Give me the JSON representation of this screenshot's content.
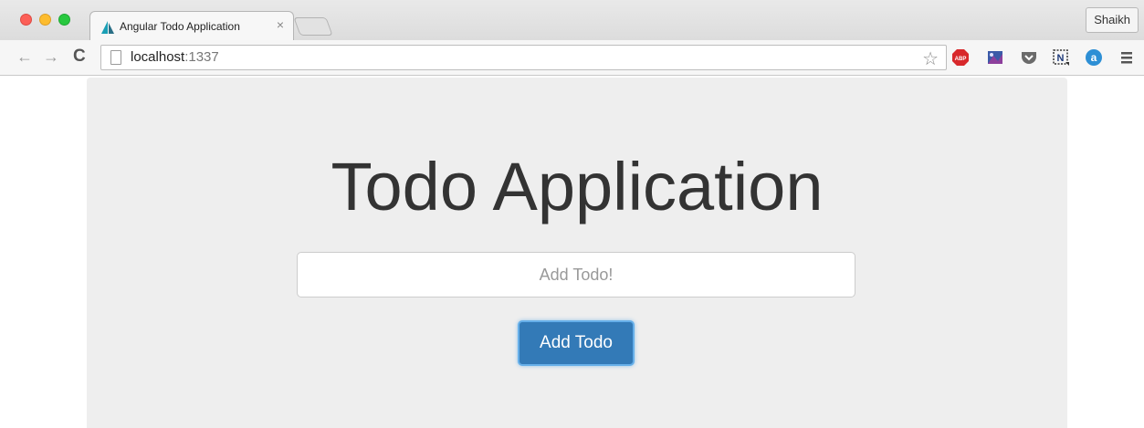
{
  "browser": {
    "tab": {
      "title": "Angular Todo Application",
      "close_glyph": "×"
    },
    "profile_name": "Shaikh",
    "toolbar": {
      "back_glyph": "←",
      "forward_glyph": "→",
      "reload_glyph": "C",
      "url_host": "localhost",
      "url_port": ":1337",
      "star_glyph": "☆",
      "menu_glyph": "≡"
    },
    "extensions": [
      "adblock-plus-icon",
      "image-extension-icon",
      "pocket-icon",
      "notion-clipper-icon",
      "at-sign-icon"
    ]
  },
  "page": {
    "title": "Todo Application",
    "input": {
      "placeholder": "Add Todo!",
      "value": ""
    },
    "add_button_label": "Add Todo"
  },
  "colors": {
    "primary_button": "#337ab7",
    "jumbotron_bg": "#eeeeee",
    "title_text": "#333333"
  }
}
